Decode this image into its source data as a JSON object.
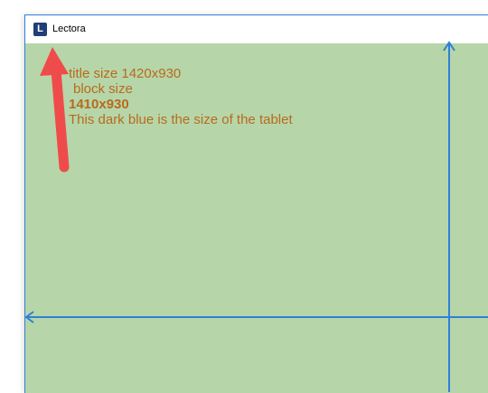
{
  "window": {
    "title": "Lectora",
    "logo_letter": "L"
  },
  "content": {
    "background_color": "#b6d6a9",
    "text_color": "#b86a1c",
    "lines": [
      "title size 1420x930",
      "block size",
      "1410x930",
      "This dark blue is the size of the tablet"
    ]
  },
  "annotations": {
    "arrow_color": "#f04b4b",
    "guide_color": "#2f7fd8"
  }
}
